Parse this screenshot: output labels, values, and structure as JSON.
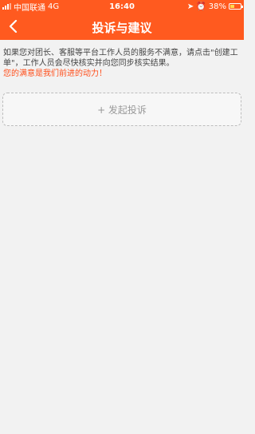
{
  "status_bar": {
    "carrier": "中国联通",
    "network": "4G",
    "time": "16:40",
    "battery": "38%"
  },
  "nav": {
    "title": "投诉与建议"
  },
  "notice": {
    "text": "如果您对团长、客服等平台工作人员的服务不满意，请点击\"创建工单\"，工作人员会尽快核实并向您同步核实结果。",
    "highlight": "您的满意是我们前进的动力！"
  },
  "actions": {
    "create_complaint": "+ 发起投诉"
  },
  "colors": {
    "brand": "#ff5a1f",
    "highlight_text": "#ff4e1a"
  }
}
